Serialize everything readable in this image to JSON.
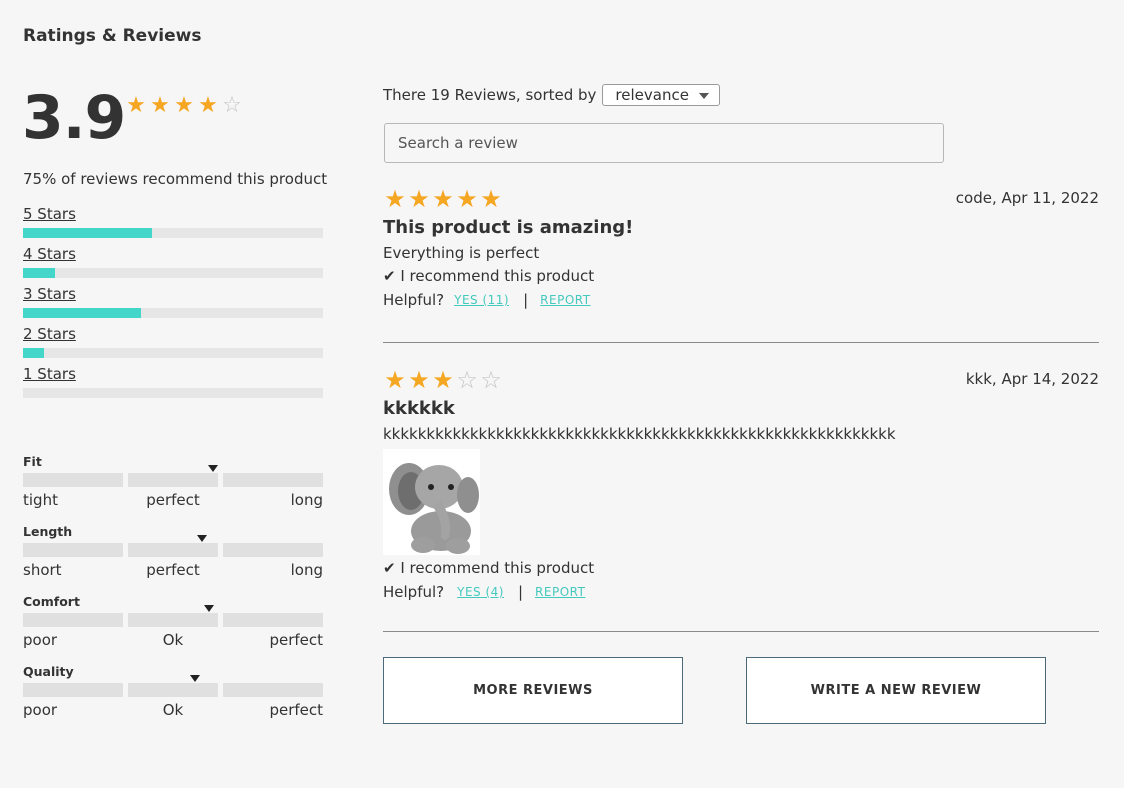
{
  "header": {
    "title": "Ratings & Reviews"
  },
  "summary": {
    "average": "3.9",
    "average_rating": 3.9,
    "recommend_text": "75% of reviews recommend this product"
  },
  "breakdown": [
    {
      "label": "5 Stars",
      "fraction": 0.43
    },
    {
      "label": "4 Stars",
      "fraction": 0.107
    },
    {
      "label": "3 Stars",
      "fraction": 0.393
    },
    {
      "label": "2 Stars",
      "fraction": 0.07
    },
    {
      "label": "1 Stars",
      "fraction": 0.0
    }
  ],
  "characteristics": [
    {
      "name": "Fit",
      "labels": [
        "tight",
        "perfect",
        "long"
      ],
      "value": 0.633
    },
    {
      "name": "Length",
      "labels": [
        "short",
        "perfect",
        "long"
      ],
      "value": 0.597
    },
    {
      "name": "Comfort",
      "labels": [
        "poor",
        "Ok",
        "perfect"
      ],
      "value": 0.62
    },
    {
      "name": "Quality",
      "labels": [
        "poor",
        "Ok",
        "perfect"
      ],
      "value": 0.573
    }
  ],
  "list": {
    "sort_prefix": "There 19 Reviews, sorted by",
    "sort_value": "relevance",
    "search_placeholder": "Search a review"
  },
  "reviews": [
    {
      "rating": 5,
      "meta": "code, Apr 11, 2022",
      "title": "This product is amazing!",
      "body": "Everything is perfect",
      "recommend": "✔ I recommend this product",
      "helpful_label": "Helpful?",
      "yes_label": "YES (11)",
      "separator": "|",
      "report_label": "REPORT"
    },
    {
      "rating": 3,
      "meta": "kkk, Apr 14, 2022",
      "title": "kkkkkk",
      "body": "kkkkkkkkkkkkkkkkkkkkkkkkkkkkkkkkkkkkkkkkkkkkkkkkkkkkkkkkkkk",
      "recommend": "✔ I recommend this product",
      "helpful_label": "Helpful?",
      "yes_label": "YES (4)",
      "separator": "|",
      "report_label": "REPORT"
    }
  ],
  "actions": {
    "more_reviews": "MORE REVIEWS",
    "write_review": "WRITE A NEW REVIEW"
  },
  "icons": {
    "star": "star-icon",
    "check": "check-icon"
  },
  "colors": {
    "star": "#f5a623",
    "bar": "#44d7c9",
    "link": "#44c9bd"
  }
}
